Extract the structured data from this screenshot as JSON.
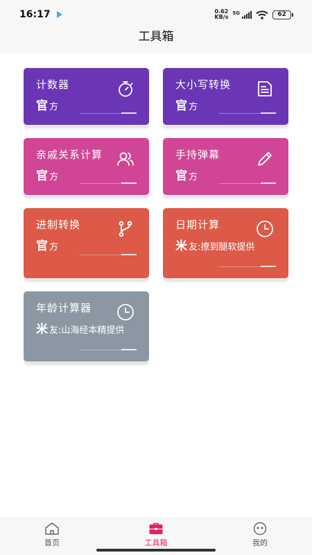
{
  "status_bar": {
    "time": "16:17",
    "net_speed_value": "0.62",
    "net_speed_unit": "KB/s",
    "network_gen": "5G",
    "battery": "62"
  },
  "header": {
    "title": "工具箱"
  },
  "cards": [
    {
      "title": "计数器",
      "credit_big": "官",
      "credit_rest": "方",
      "icon": "stopwatch-icon",
      "color": "#6a36b6"
    },
    {
      "title": "大小写转换",
      "credit_big": "官",
      "credit_rest": "方",
      "icon": "document-icon",
      "color": "#6a36b6"
    },
    {
      "title": "亲戚关系计算",
      "credit_big": "官",
      "credit_rest": "方",
      "icon": "users-icon",
      "color": "#d04595"
    },
    {
      "title": "手持弹幕",
      "credit_big": "官",
      "credit_rest": "方",
      "icon": "pencil-icon",
      "color": "#d04595"
    },
    {
      "title": "进制转换",
      "credit_big": "官",
      "credit_rest": "方",
      "icon": "git-branch-icon",
      "color": "#dc5a47"
    },
    {
      "title": "日期计算",
      "credit_big": "米",
      "credit_rest": "友:撩到腿软提供",
      "icon": "clock-icon",
      "color": "#dc5a47"
    },
    {
      "title": "年龄计算器",
      "credit_big": "米",
      "credit_rest": "友:山海经本精提供",
      "icon": "clock-icon",
      "color": "#8b98a3"
    }
  ],
  "bottom_nav": [
    {
      "label": "首页",
      "icon": "home-icon",
      "active": false
    },
    {
      "label": "工具箱",
      "icon": "toolbox-icon",
      "active": true
    },
    {
      "label": "我的",
      "icon": "smiley-icon",
      "active": false
    }
  ],
  "colors": {
    "active_tab": "#e0245e",
    "purple": "#6a36b6",
    "pink": "#d04595",
    "orange": "#dc5a47",
    "gray": "#8b98a3"
  }
}
